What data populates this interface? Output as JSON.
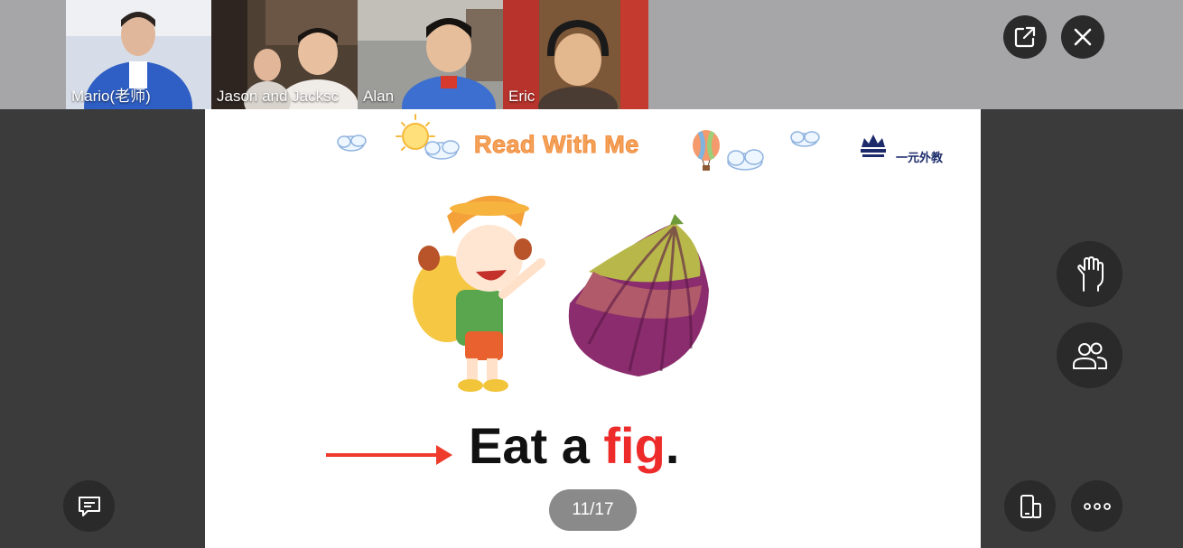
{
  "participants": [
    {
      "name": "Mario(老师)",
      "bg": "#c9d3e6"
    },
    {
      "name": "Jason and Jacksc",
      "bg": "#5a4a3e"
    },
    {
      "name": "Alan",
      "bg": "#8d8f8c"
    },
    {
      "name": "Eric",
      "bg": "#8a5a3c"
    }
  ],
  "slide": {
    "title": "Read With Me",
    "brand": "一元外教",
    "sentence_start": "Eat a ",
    "sentence_highlight": "fig",
    "sentence_end": "."
  },
  "pager": {
    "label": "11/17"
  },
  "icons": {
    "popout": "external-link-icon",
    "close": "close-icon",
    "raise_hand": "hand-icon",
    "participants": "people-icon",
    "device": "device-icon",
    "more": "more-icon",
    "chat": "chat-icon"
  },
  "colors": {
    "toolbar_bg": "#a6a6a8",
    "stage_bg": "#3b3b3c",
    "button_bg": "#2a2a2b",
    "title_orange": "#f4a45a",
    "highlight_red": "#ee2b2b"
  }
}
